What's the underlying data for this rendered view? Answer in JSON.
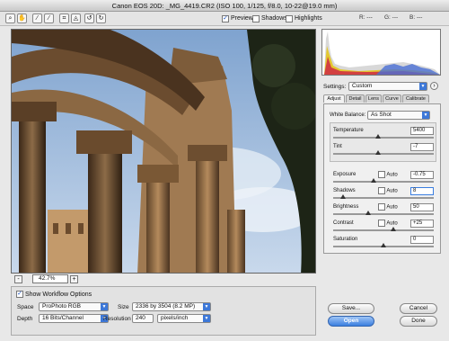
{
  "window": {
    "title": "Canon EOS 20D:  _MG_4419.CR2  (ISO 100, 1/125, f/8.0, 10-22@19.0 mm)"
  },
  "toolbar": {
    "tools": [
      "zoom-icon",
      "hand-icon",
      "white-balance-icon",
      "color-sampler-icon",
      "crop-icon",
      "straighten-icon",
      "rotate-ccw-icon",
      "rotate-cw-icon"
    ],
    "preview_label": "Preview",
    "shadows_label": "Shadows",
    "highlights_label": "Highlights",
    "r_readout": "R: ---",
    "g_readout": "G: ---",
    "b_readout": "B: ---"
  },
  "zoom": {
    "minus": "-",
    "plus": "+",
    "value": "42.7%"
  },
  "workflow": {
    "title": "Show Workflow Options",
    "space_label": "Space",
    "space_value": "ProPhoto RGB",
    "depth_label": "Depth",
    "depth_value": "16 Bits/Channel",
    "size_label": "Size",
    "size_value": "2336 by 3504  (8.2 MP)",
    "resolution_label": "Resolution",
    "resolution_value": "240",
    "resolution_unit": "pixels/inch"
  },
  "settings": {
    "label": "Settings:",
    "value": "Custom"
  },
  "tabs": [
    "Adjust",
    "Detail",
    "Lens",
    "Curve",
    "Calibrate"
  ],
  "adjust": {
    "white_balance_label": "White Balance:",
    "white_balance_value": "As Shot",
    "auto_label": "Auto",
    "rows": [
      {
        "label": "Temperature",
        "value": "5400",
        "thumb": 0.45
      },
      {
        "label": "Tint",
        "value": "-7",
        "thumb": 0.45
      },
      {
        "label": "Exposure",
        "value": "-0.75",
        "thumb": 0.4
      },
      {
        "label": "Shadows",
        "value": "8",
        "thumb": 0.1
      },
      {
        "label": "Brightness",
        "value": "50",
        "thumb": 0.35
      },
      {
        "label": "Contrast",
        "value": "+25",
        "thumb": 0.6
      },
      {
        "label": "Saturation",
        "value": "0",
        "thumb": 0.5
      }
    ]
  },
  "buttons": {
    "save": "Save...",
    "open": "Open",
    "cancel": "Cancel",
    "done": "Done"
  },
  "colors": {
    "accent": "#3a7ee0",
    "sky": "#a6c1de",
    "stone": "#8a6a48"
  }
}
